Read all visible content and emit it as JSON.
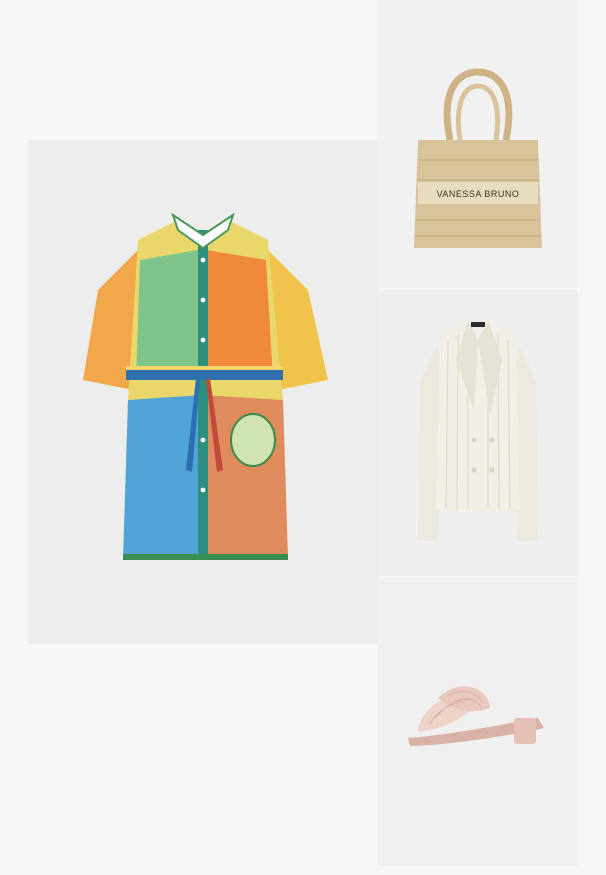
{
  "products": [
    {
      "kind": "dress",
      "icon": "printed-shirt-dress-image"
    },
    {
      "kind": "bag",
      "icon": "tote-bag-image",
      "brand_text": "VANESSA BRUNO"
    },
    {
      "kind": "blazer",
      "icon": "pinstripe-blazer-image"
    },
    {
      "kind": "shoe",
      "icon": "pleated-mule-sandal-image"
    }
  ],
  "colors": {
    "page": "#f6f6f6",
    "tile": "#efefef",
    "straw": "#d9c39a",
    "blazer": "#f1efe6",
    "shoe": "#e9c9bd"
  }
}
